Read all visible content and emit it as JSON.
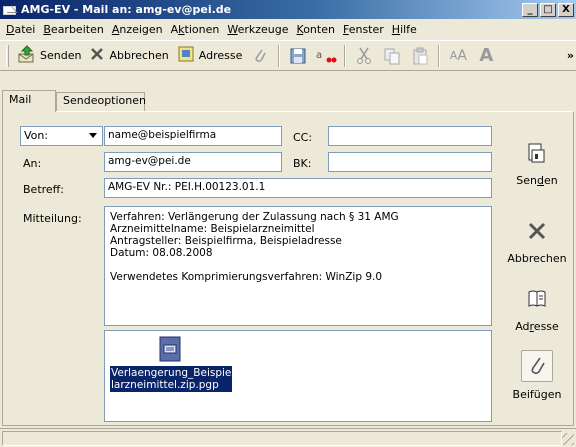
{
  "window": {
    "title": "AMG-EV - Mail an: amg-ev@pei.de",
    "buttons": {
      "minimize": "_",
      "maximize": "□",
      "close": "X"
    }
  },
  "menubar": [
    {
      "label": "Datei",
      "accel": "D"
    },
    {
      "label": "Bearbeiten",
      "accel": "B"
    },
    {
      "label": "Anzeigen",
      "accel": "A"
    },
    {
      "label": "Aktionen",
      "accel": "k"
    },
    {
      "label": "Werkzeuge",
      "accel": "W"
    },
    {
      "label": "Konten",
      "accel": "K"
    },
    {
      "label": "Fenster",
      "accel": "F"
    },
    {
      "label": "Hilfe",
      "accel": "H"
    }
  ],
  "toolbar": {
    "send_label": "Senden",
    "cancel_label": "Abbrechen",
    "address_label": "Adresse",
    "overflow": "»",
    "icons": [
      "send-icon",
      "cancel-icon",
      "address-book-icon",
      "paperclip-icon",
      "save-icon",
      "spellcheck-icon",
      "cut-icon",
      "copy-icon",
      "paste-icon",
      "font-size-small-icon",
      "font-size-large-icon"
    ],
    "font_small": "A",
    "font_large": "A"
  },
  "tabs": [
    {
      "label": "Mail",
      "active": true
    },
    {
      "label": "Sendeoptionen",
      "active": false
    }
  ],
  "form": {
    "from_label": "Von:",
    "from_value": "name@beispielfirma",
    "cc_label": "CC:",
    "cc_value": "",
    "to_label": "An:",
    "to_value": "amg-ev@pei.de",
    "bcc_label": "BK:",
    "bcc_value": "",
    "subject_label": "Betreff:",
    "subject_value": "AMG-EV Nr.: PEI.H.00123.01.1",
    "message_label": "Mitteilung:",
    "message_lines": [
      "Verfahren: Verlängerung der Zulassung nach § 31 AMG",
      "Arzneimittelname: Beispielarzneimittel",
      "Antragsteller: Beispielfirma, Beispieladresse",
      "Datum: 08.08.2008",
      "",
      "Verwendetes Komprimierungsverfahren: WinZip 9.0"
    ],
    "attachment_line1": "Verlaengerung_Beispie",
    "attachment_line2": "larzneimittel.zip.pgp"
  },
  "side": {
    "send": "Senden",
    "cancel": "Abbrechen",
    "address": "Adresse",
    "attach": "Beifügen"
  },
  "colors": {
    "titlebar_start": "#0a246a",
    "titlebar_end": "#a6caf0",
    "face": "#ece9d8",
    "selection": "#0a246a",
    "field_border": "#7f9db9"
  }
}
